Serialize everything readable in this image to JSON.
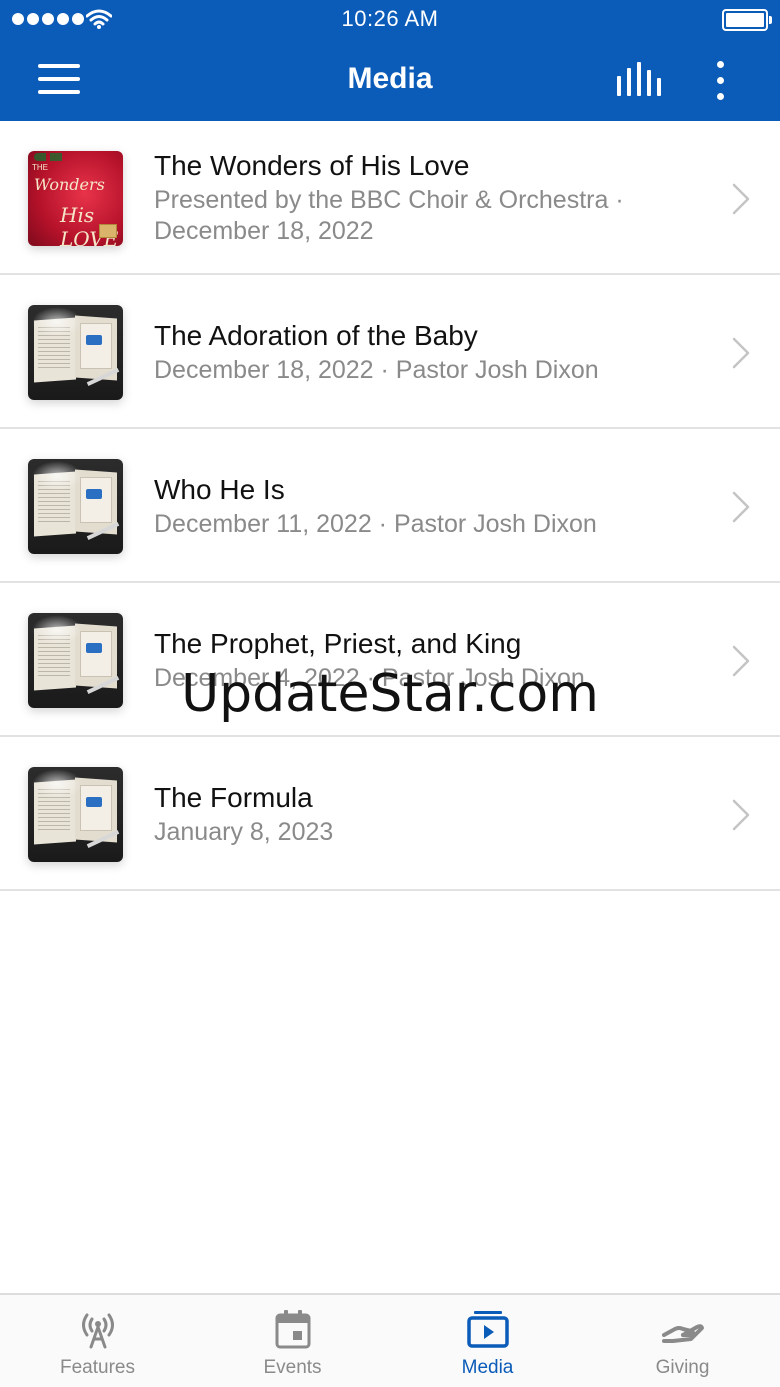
{
  "status_bar": {
    "time": "10:26 AM"
  },
  "nav": {
    "title": "Media"
  },
  "media_list": [
    {
      "title": "The Wonders of His Love",
      "subtitle": "Presented by the BBC Choir & Orchestra · December 18, 2022",
      "thumbnail": "wonders-of-his-love-art",
      "thumb_text": [
        "THE",
        "Wonders",
        "His LOVE"
      ]
    },
    {
      "title": "The Adoration of the Baby",
      "subtitle": "December 18, 2022 · Pastor Josh Dixon",
      "thumbnail": "open-bible-notes-art"
    },
    {
      "title": "Who He Is",
      "subtitle": "December 11, 2022 · Pastor Josh Dixon",
      "thumbnail": "open-bible-notes-art"
    },
    {
      "title": "The Prophet, Priest, and King",
      "subtitle": "December 4, 2022 · Pastor Josh Dixon",
      "thumbnail": "open-bible-notes-art"
    },
    {
      "title": "The Formula",
      "subtitle": "January 8, 2023",
      "thumbnail": "open-bible-notes-art"
    }
  ],
  "tabs": [
    {
      "label": "Features",
      "icon": "broadcast-tower-icon",
      "active": false
    },
    {
      "label": "Events",
      "icon": "calendar-icon",
      "active": false
    },
    {
      "label": "Media",
      "icon": "play-media-icon",
      "active": true
    },
    {
      "label": "Giving",
      "icon": "giving-hand-icon",
      "active": false
    }
  ],
  "watermark": "UpdateStar.com",
  "colors": {
    "header_blue": "#0b5bb8",
    "active_tab": "#0b5bb8",
    "inactive_tab": "#8a8a8a",
    "subtitle_gray": "#8a8a8a",
    "divider": "#e2e2e2"
  }
}
